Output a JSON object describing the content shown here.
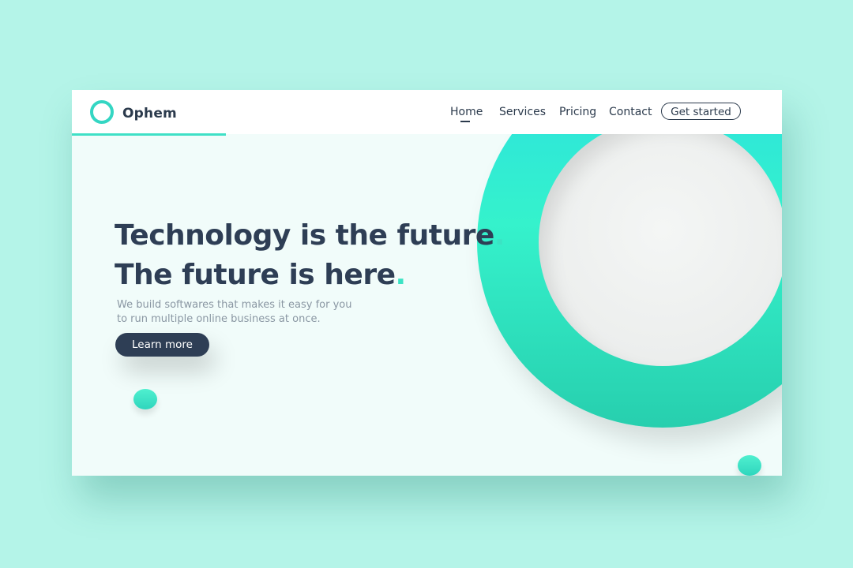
{
  "brand": {
    "name": "Ophem"
  },
  "nav": {
    "home": "Home",
    "services": "Services",
    "pricing": "Pricing",
    "contact": "Contact",
    "cta": "Get started"
  },
  "hero": {
    "headline_line1": "Technology is the future",
    "headline_line2": "The future is here",
    "dot": ".",
    "subtext_line1": "We build softwares that makes it easy for you",
    "subtext_line2": "to run multiple online business at once.",
    "button": "Learn more"
  },
  "colors": {
    "background": "#b4f4e8",
    "accent": "#3be3c4",
    "text_dark": "#2e3e55"
  }
}
